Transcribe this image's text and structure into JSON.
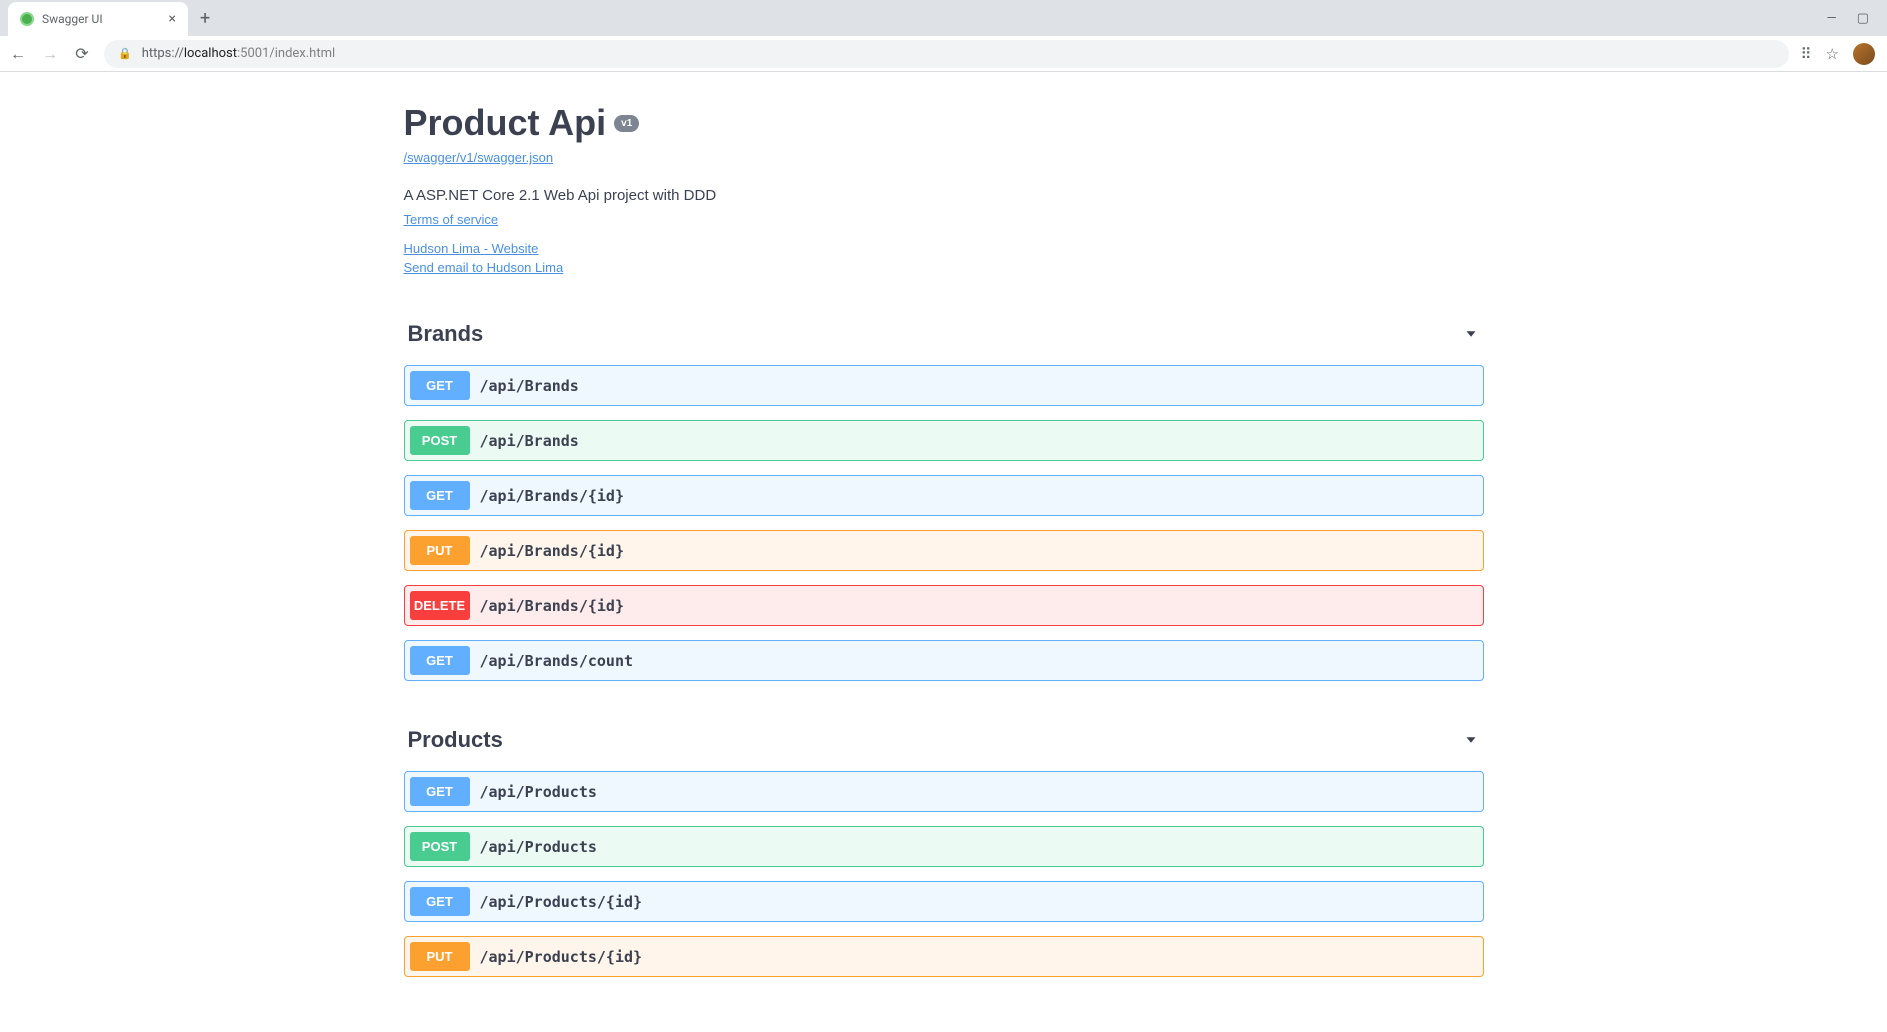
{
  "browser": {
    "tab_title": "Swagger UI",
    "url_prefix": "https://",
    "url_host": "localhost",
    "url_rest": ":5001/index.html"
  },
  "info": {
    "title": "Product Api",
    "version": "v1",
    "swagger_json_link": "/swagger/v1/swagger.json",
    "description": "A ASP.NET Core 2.1 Web Api project with DDD",
    "terms_link": "Terms of service",
    "contact_website": "Hudson Lima - Website",
    "contact_email": "Send email to Hudson Lima"
  },
  "tags": [
    {
      "name": "Brands",
      "operations": [
        {
          "method": "GET",
          "path": "/api/Brands"
        },
        {
          "method": "POST",
          "path": "/api/Brands"
        },
        {
          "method": "GET",
          "path": "/api/Brands/{id}"
        },
        {
          "method": "PUT",
          "path": "/api/Brands/{id}"
        },
        {
          "method": "DELETE",
          "path": "/api/Brands/{id}"
        },
        {
          "method": "GET",
          "path": "/api/Brands/count"
        }
      ]
    },
    {
      "name": "Products",
      "operations": [
        {
          "method": "GET",
          "path": "/api/Products"
        },
        {
          "method": "POST",
          "path": "/api/Products"
        },
        {
          "method": "GET",
          "path": "/api/Products/{id}"
        },
        {
          "method": "PUT",
          "path": "/api/Products/{id}"
        }
      ]
    }
  ],
  "method_colors": {
    "GET": "#61affe",
    "POST": "#49cc90",
    "PUT": "#fca130",
    "DELETE": "#f93e3e"
  }
}
